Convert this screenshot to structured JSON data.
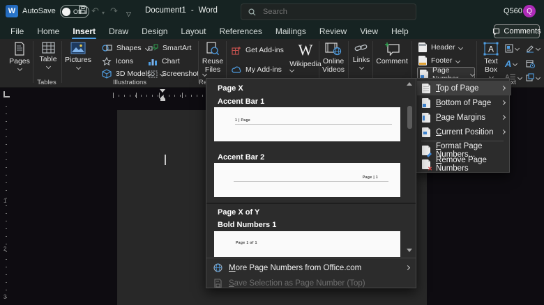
{
  "colors": {
    "accent_blue": "#4f9ee3",
    "avatar_purple": "#ae2bb8",
    "titlebar_bg": "#162322",
    "ribbon_bg": "#262626",
    "popup_bg": "#2c2c2c",
    "canvas_bg": "#0e0c11",
    "page_bg": "#282828",
    "preview_bg": "#fafafa"
  },
  "titlebar": {
    "autosave_label": "AutoSave",
    "autosave_state": "Off",
    "document_title": "Document1",
    "title_separator": "-",
    "app_name": "Word",
    "search_placeholder": "Search",
    "account_id": "Q560",
    "avatar_initial": "Q"
  },
  "menubar": {
    "tabs": [
      "File",
      "Home",
      "Insert",
      "Draw",
      "Design",
      "Layout",
      "References",
      "Mailings",
      "Review",
      "View",
      "Help"
    ],
    "active_tab": "Insert",
    "comments_label": "Comments"
  },
  "ribbon": {
    "groups": {
      "tables": {
        "label": "Tables",
        "pages": "Pages",
        "table": "Table"
      },
      "illustrations": {
        "label": "Illustrations",
        "pictures": "Pictures",
        "shapes": "Shapes",
        "icons": "Icons",
        "models": "3D Models",
        "smartart": "SmartArt",
        "chart": "Chart",
        "screenshot": "Screenshot"
      },
      "reuse": {
        "label": "Reuse Files",
        "reuse_files": "Reuse Files"
      },
      "addins": {
        "get_addins": "Get Add-ins",
        "my_addins": "My Add-ins",
        "wikipedia": "Wikipedia"
      },
      "media": {
        "online_videos": "Online Videos",
        "links": "Links",
        "comment": "Comment"
      },
      "header_footer": {
        "header": "Header",
        "footer": "Footer",
        "page_number": "Page Number"
      },
      "text": {
        "label": "Text",
        "text_box": "Text Box"
      }
    }
  },
  "page_number_menu": {
    "items": [
      {
        "label": "Top of Page",
        "submenu": true,
        "highlighted": true
      },
      {
        "label": "Bottom of Page",
        "submenu": true
      },
      {
        "label": "Page Margins",
        "submenu": true
      },
      {
        "label": "Current Position",
        "submenu": true
      },
      {
        "label": "Format Page Numbers...",
        "submenu": false
      },
      {
        "label": "Remove Page Numbers",
        "submenu": false
      }
    ]
  },
  "gallery": {
    "sections": [
      {
        "header": "Page X",
        "items": [
          {
            "name": "Accent Bar 1",
            "preview_text": "1 | Page"
          },
          {
            "name": "Accent Bar 2",
            "preview_text": "Page | 1"
          }
        ]
      },
      {
        "header": "Page X of Y",
        "items": [
          {
            "name": "Bold Numbers 1",
            "preview_text": "Page 1 of 1"
          }
        ]
      }
    ],
    "footer": [
      {
        "label": "More Page Numbers from Office.com",
        "disabled": false
      },
      {
        "label": "Save Selection as Page Number (Top)",
        "disabled": true
      }
    ]
  },
  "ruler": {
    "numbers": [
      "1",
      "2",
      "3"
    ]
  }
}
